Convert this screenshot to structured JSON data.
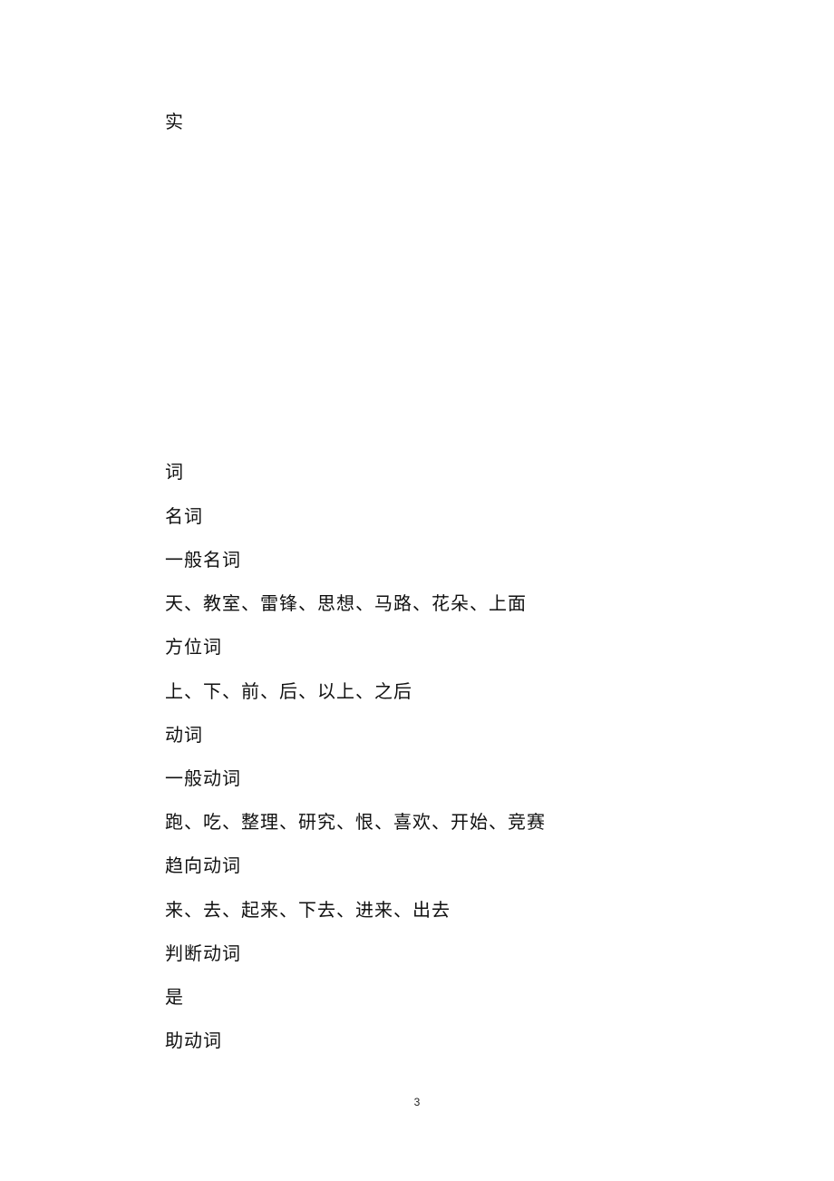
{
  "document": {
    "header_char": "实",
    "lines": [
      "词",
      "名词",
      "一般名词",
      "天、教室、雷锋、思想、马路、花朵、上面",
      "方位词",
      "上、下、前、后、以上、之后",
      "动词",
      "一般动词",
      "跑、吃、整理、研究、恨、喜欢、开始、竞赛",
      "趋向动词",
      "来、去、起来、下去、进来、出去",
      "判断动词",
      "是",
      "助动词"
    ],
    "page_number": "3"
  }
}
